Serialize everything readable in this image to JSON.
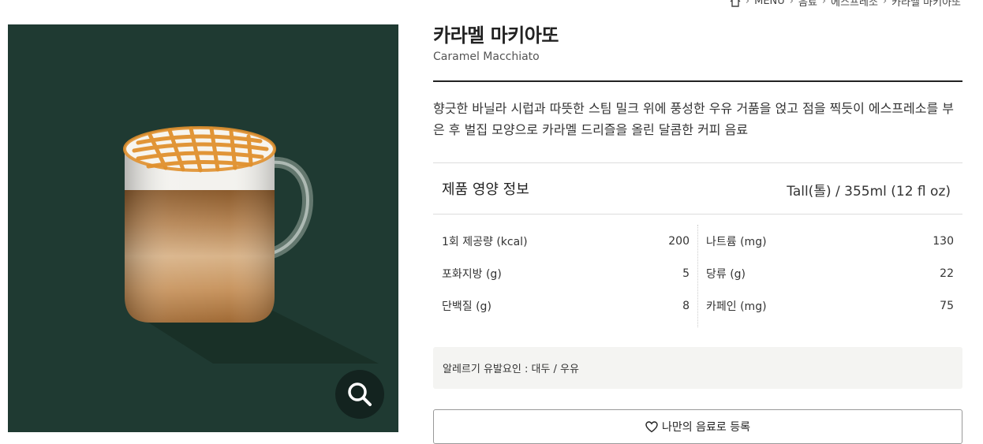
{
  "breadcrumb": {
    "items": [
      "MENU",
      "음료",
      "에스프레소",
      "카라멜 마키아또"
    ]
  },
  "product": {
    "name_ko": "카라멜 마키아또",
    "name_en": "Caramel Macchiato",
    "description": "향긋한 바닐라 시럽과 따뜻한 스팀 밀크 위에 풍성한 우유 거품을 얹고 점을 찍듯이 에스프레소를 부은 후 벌집 모양으로 카라멜 드리즐을 올린 달콤한 커피 음료"
  },
  "nutrition": {
    "title": "제품 영양 정보",
    "size": "Tall(톨) / 355ml (12 fl oz)",
    "left": [
      {
        "label": "1회 제공량 (kcal)",
        "value": "200"
      },
      {
        "label": "포화지방 (g)",
        "value": "5"
      },
      {
        "label": "단백질 (g)",
        "value": "8"
      }
    ],
    "right": [
      {
        "label": "나트륨 (mg)",
        "value": "130"
      },
      {
        "label": "당류 (g)",
        "value": "22"
      },
      {
        "label": "카페인 (mg)",
        "value": "75"
      }
    ]
  },
  "allergy": {
    "text": "알레르기 유발요인 : 대두 / 우유"
  },
  "actions": {
    "favorite_label": "나만의 음료로 등록"
  },
  "icons": {
    "home": "home-icon",
    "zoom": "magnifier-icon",
    "favorite": "heart-outline-icon"
  },
  "colors": {
    "photo_background": "#1f3a32",
    "zoom_button": "#13231f",
    "allergy_background": "#f4f4f2"
  }
}
